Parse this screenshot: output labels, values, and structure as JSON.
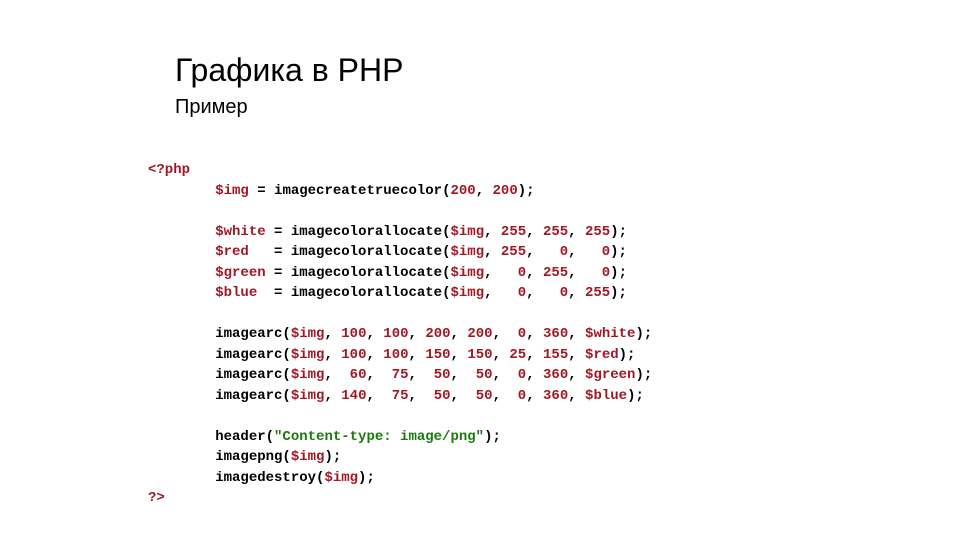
{
  "title": "Графика в PHP",
  "subtitle": "Пример",
  "code": {
    "open_tag": "<?php",
    "l1": {
      "var": "$img",
      "eq": " = ",
      "fn": "imagecreatetruecolor(",
      "a1": "200",
      "c": ", ",
      "a2": "200",
      "end": ");"
    },
    "l2": {
      "var": "$white",
      "pad": " = ",
      "fn": "imagecolorallocate(",
      "v": "$img",
      "c1": ", ",
      "n1": "255",
      "c2": ", ",
      "n2": "255",
      "c3": ", ",
      "n3": "255",
      "end": ");"
    },
    "l3": {
      "var": "$red",
      "pad": "   = ",
      "fn": "imagecolorallocate(",
      "v": "$img",
      "c1": ", ",
      "n1": "255",
      "c2": ",   ",
      "n2": "0",
      "c3": ",   ",
      "n3": "0",
      "end": ");"
    },
    "l4": {
      "var": "$green",
      "pad": " = ",
      "fn": "imagecolorallocate(",
      "v": "$img",
      "c1": ",   ",
      "n1": "0",
      "c2": ", ",
      "n2": "255",
      "c3": ",   ",
      "n3": "0",
      "end": ");"
    },
    "l5": {
      "var": "$blue",
      "pad": "  = ",
      "fn": "imagecolorallocate(",
      "v": "$img",
      "c1": ",   ",
      "n1": "0",
      "c2": ",   ",
      "n2": "0",
      "c3": ", ",
      "n3": "255",
      "end": ");"
    },
    "l6": {
      "fn": "imagearc(",
      "v": "$img",
      "c1": ", ",
      "n1": "100",
      "c2": ", ",
      "n2": "100",
      "c3": ", ",
      "n3": "200",
      "c4": ", ",
      "n4": "200",
      "c5": ",  ",
      "n5": "0",
      "c6": ", ",
      "n6": "360",
      "c7": ", ",
      "var": "$white",
      "end": ");"
    },
    "l7": {
      "fn": "imagearc(",
      "v": "$img",
      "c1": ", ",
      "n1": "100",
      "c2": ", ",
      "n2": "100",
      "c3": ", ",
      "n3": "150",
      "c4": ", ",
      "n4": "150",
      "c5": ", ",
      "n5": "25",
      "c6": ", ",
      "n6": "155",
      "c7": ", ",
      "var": "$red",
      "end": ");"
    },
    "l8": {
      "fn": "imagearc(",
      "v": "$img",
      "c1": ",  ",
      "n1": "60",
      "c2": ",  ",
      "n2": "75",
      "c3": ",  ",
      "n3": "50",
      "c4": ",  ",
      "n4": "50",
      "c5": ",  ",
      "n5": "0",
      "c6": ", ",
      "n6": "360",
      "c7": ", ",
      "var": "$green",
      "end": ");"
    },
    "l9": {
      "fn": "imagearc(",
      "v": "$img",
      "c1": ", ",
      "n1": "140",
      "c2": ",  ",
      "n2": "75",
      "c3": ",  ",
      "n3": "50",
      "c4": ",  ",
      "n4": "50",
      "c5": ",  ",
      "n5": "0",
      "c6": ", ",
      "n6": "360",
      "c7": ", ",
      "var": "$blue",
      "end": ");"
    },
    "l10": {
      "fn": "header(",
      "str": "\"Content-type: image/png\"",
      "end": ");"
    },
    "l11": {
      "fn": "imagepng(",
      "v": "$img",
      "end": ");"
    },
    "l12": {
      "fn": "imagedestroy(",
      "v": "$img",
      "end": ");"
    },
    "close_tag": "?>"
  }
}
